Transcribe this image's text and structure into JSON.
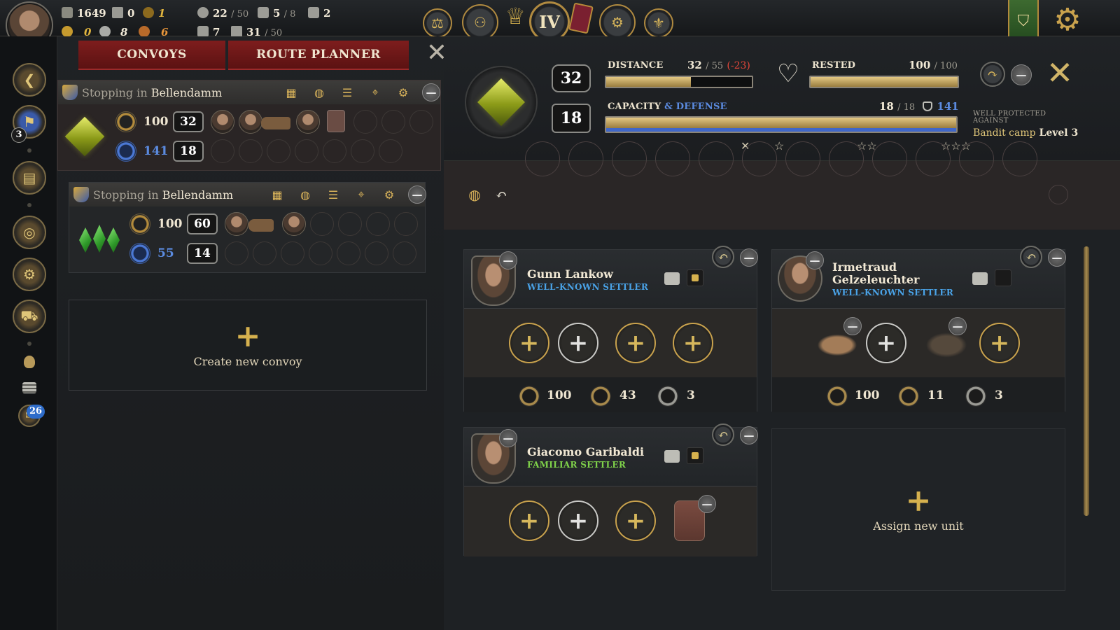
{
  "colors": {
    "accent_gold": "#d6b14e",
    "tab_red": "#7e1d1d",
    "defense_blue": "#5b8be0",
    "negative_red": "#e3473a",
    "rank_blue": "#4aa3e8",
    "rank_green": "#7fd24a"
  },
  "topbar": {
    "resources": {
      "wood": {
        "icon": "log-icon",
        "value": "1649"
      },
      "iron": {
        "icon": "anvil-icon",
        "value": "0"
      },
      "influence": {
        "icon": "crown-coin-icon",
        "value": "1"
      },
      "gold": {
        "icon": "gold-coin-icon",
        "value": "0"
      },
      "silver": {
        "icon": "silver-coin-icon",
        "value": "8"
      },
      "copper": {
        "icon": "copper-coin-icon",
        "value": "6"
      },
      "population": {
        "icon": "people-icon",
        "value": "22",
        "max": "/ 50"
      },
      "buildings": {
        "icon": "shield-emblem-icon",
        "value": "5",
        "max": "/ 8"
      },
      "horses": {
        "icon": "horse-icon",
        "value": "2"
      },
      "workshops": {
        "icon": "house-gear-icon",
        "value": "7"
      },
      "storage": {
        "icon": "crate-icon",
        "value": "31",
        "max": "/ 50"
      }
    },
    "era_numeral": "IV",
    "center_icons": [
      "scales-icon",
      "pawns-icon",
      "trophy-icon",
      "book-icon",
      "compass-icon",
      "fleur-de-lis-icon"
    ]
  },
  "sidebar": {
    "items": [
      {
        "name": "back-arrow-icon",
        "glyph": "❮"
      },
      {
        "name": "quest-flag-icon",
        "glyph": "⚑",
        "badge": "3"
      },
      {
        "name": "codex-book-icon",
        "glyph": "▤"
      },
      {
        "name": "coin-ledger-icon",
        "glyph": "◎"
      },
      {
        "name": "gear-shield-icon",
        "glyph": "⚙"
      },
      {
        "name": "cart-icon",
        "glyph": "⛟"
      },
      {
        "name": "sack-icon",
        "glyph": "◍"
      },
      {
        "name": "coins-stack-icon",
        "glyph": "≡"
      },
      {
        "name": "messenger-icon",
        "glyph": "✉",
        "badge": "26"
      }
    ]
  },
  "tabs": {
    "convoys": "CONVOYS",
    "route_planner": "ROUTE PLANNER"
  },
  "convoys": [
    {
      "stop_prefix": "Stopping in",
      "stop_town": "Bellendamm",
      "health": "100",
      "capacity": "32",
      "defense": "141",
      "units": "18"
    },
    {
      "stop_prefix": "Stopping in",
      "stop_town": "Bellendamm",
      "health": "100",
      "capacity": "60",
      "defense": "55",
      "units": "14"
    }
  ],
  "create_convoy": {
    "label": "Create new convoy",
    "plus": "+"
  },
  "detail": {
    "capacity_badge": "32",
    "units_badge": "18",
    "distance": {
      "label": "DISTANCE",
      "value": "32",
      "max": "/ 55",
      "delta": "(-23)",
      "fill": 0.58
    },
    "rested": {
      "label": "RESTED",
      "value": "100",
      "max": "/ 100",
      "fill": 1.0
    },
    "capacity": {
      "label": "CAPACITY",
      "label_blue": "& DEFENSE",
      "value": "18",
      "max": "/ 18",
      "defense": "141",
      "fill": 1.0
    },
    "tier_marks": [
      "✕",
      "☆",
      "☆☆",
      "☆☆☆"
    ],
    "protection_label": "WELL PROTECTED AGAINST",
    "protection_value": "Bandit camp",
    "protection_level": "Level 3"
  },
  "units": [
    {
      "name": "Gunn Lankow",
      "rank": "WELL-KNOWN SETTLER",
      "rank_color": "#4aa3e8",
      "health": "100",
      "defense": "43",
      "boots": "3"
    },
    {
      "name_line1": "Irmetraud",
      "name_line2": "Gelzeleuchter",
      "rank": "WELL-KNOWN SETTLER",
      "rank_color": "#4aa3e8",
      "health": "100",
      "defense": "11",
      "boots": "3"
    },
    {
      "name": "Giacomo Garibaldi",
      "rank": "FAMILIAR SETTLER",
      "rank_color": "#7fd24a"
    }
  ],
  "assign_unit": {
    "label": "Assign new unit",
    "plus": "+"
  }
}
